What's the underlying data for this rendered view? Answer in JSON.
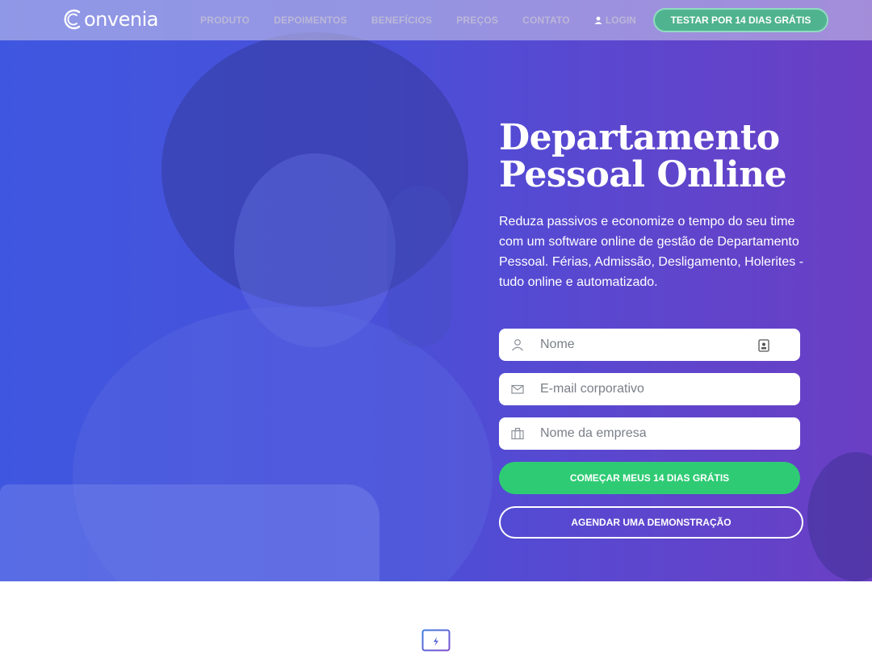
{
  "nav": {
    "brand": "onvenia",
    "links": [
      "PRODUTO",
      "DEPOIMENTOS",
      "BENEFÍCIOS",
      "PREÇOS",
      "CONTATO"
    ],
    "login": "LOGIN",
    "cta": "TESTAR POR 14 DIAS GRÁTIS"
  },
  "hero": {
    "title_line1": "Departamento",
    "title_line2": "Pessoal Online",
    "description": "Reduza passivos e economize o tempo do seu time com um software online de gestão de Departamento Pessoal. Férias, Admissão, Desligamento, Holerites - tudo online e automatizado."
  },
  "form": {
    "name_placeholder": "Nome",
    "email_placeholder": "E-mail corporativo",
    "company_placeholder": "Nome da empresa",
    "submit": "COMEÇAR MEUS 14 DIAS GRÁTIS",
    "demo": "AGENDAR UMA DEMONSTRAÇÃO"
  },
  "colors": {
    "accent_green": "#2fcb74",
    "hero_blue": "#4a4fd8",
    "nav_cta": "#4fb38f"
  }
}
